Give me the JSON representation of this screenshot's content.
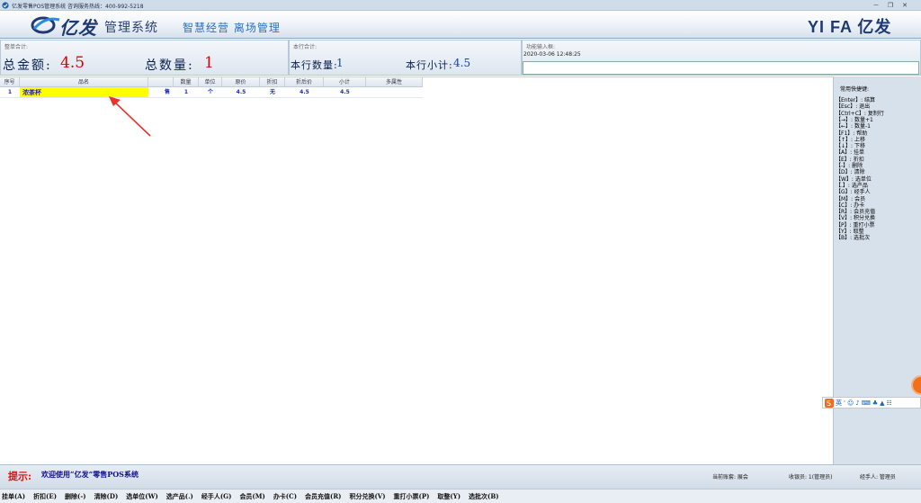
{
  "window": {
    "title": "亿发零售POS管理系统 咨询服务热线：400-992-5218",
    "minimize": "－",
    "restore": "❐",
    "close": "✕"
  },
  "banner": {
    "logo_text": "亿发",
    "logo_sub": "管理系统",
    "slogan": "智慧经营  离场管理",
    "brand": "YI FA 亿发",
    "accent": "#1f3a73"
  },
  "summary": {
    "order_label": "整单合计:",
    "total_amount_label": "总金额:",
    "total_amount": "4.5",
    "total_qty_label": "总数量:",
    "total_qty": "1",
    "row_label": "本行合计:",
    "row_qty_label": "本行数量:",
    "row_qty": "1",
    "row_subtotal_label": "本行小计:",
    "row_subtotal": "4.5",
    "func_label": "功能输入框:",
    "datetime": "2020-03-06 12:48:25",
    "func_value": ""
  },
  "table": {
    "headers": [
      "序号",
      "品名",
      "",
      "数量",
      "单位",
      "原价",
      "折扣",
      "折后价",
      "小计",
      "多属性"
    ],
    "rows": [
      [
        "1",
        "浓茶杯",
        "售",
        "1",
        "个",
        "4.5",
        "无",
        "4.5",
        "4.5",
        ""
      ]
    ]
  },
  "shortcuts": {
    "title": "常用快捷键:",
    "items": [
      "【Enter】: 结算",
      "【Esc】: 退出",
      "【Ctrl+C】: 复制行",
      "【→】: 数量+1",
      "【←】: 数量-1",
      "【F1】: 帮助",
      "【↑】: 上移",
      "【↓】: 下移",
      "【A】: 挂单",
      "【E】: 折扣",
      "【-】: 删除",
      "【D】: 清除",
      "【W】: 选单位",
      "【.】: 选产品",
      "【G】: 经手人",
      "【M】: 会员",
      "【C】: 办卡",
      "【R】: 会员充值",
      "【V】: 积分兑换",
      "【P】: 重打小票",
      "【Y】: 取整",
      "【B】: 选批次"
    ]
  },
  "ime": {
    "lang": "英"
  },
  "status": {
    "tip_label": "提示:",
    "tip_text": "欢迎使用“亿发”零售POS系统",
    "account": "当前账套: 展会",
    "cashier": "收银员: 1(管理员)",
    "handler": "经手人: 管理员"
  },
  "function_bar": [
    "挂单(A)",
    "折扣(E)",
    "删除(-)",
    "清除(D)",
    "选单位(W)",
    "选产品(.)",
    "经手人(G)",
    "会员(M)",
    "办卡(C)",
    "会员充值(R)",
    "积分兑换(V)",
    "重打小票(P)",
    "取整(Y)",
    "选批次(B)"
  ]
}
